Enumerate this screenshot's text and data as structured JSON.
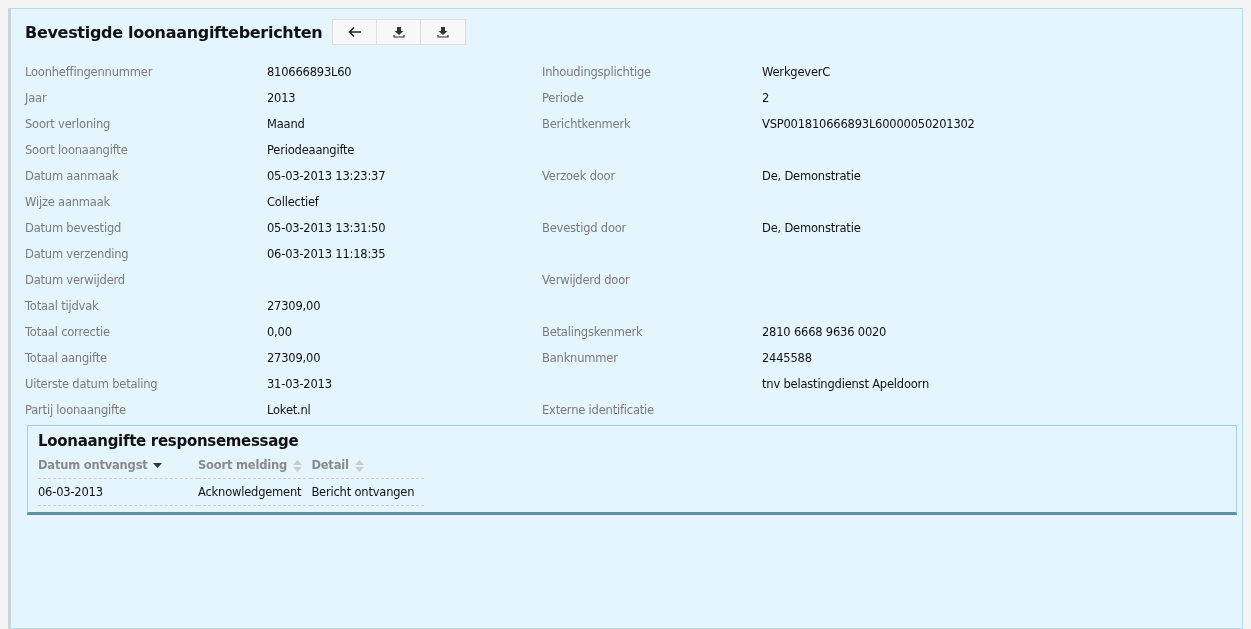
{
  "title": "Bevestigde loonaangifteberichten",
  "toolbar": [
    {
      "kind": "back"
    },
    {
      "kind": "download"
    },
    {
      "kind": "download"
    }
  ],
  "fields": [
    {
      "label": "Loonheffingennummer",
      "value": "810666893L60",
      "label_2": "Inhoudingsplichtige",
      "value_2": "WerkgeverC"
    },
    {
      "label": "Jaar",
      "value": "2013",
      "label_2": "Periode",
      "value_2": "2"
    },
    {
      "label": "Soort verloning",
      "value": "Maand",
      "label_2": "Berichtkenmerk",
      "value_2": "VSP001810666893L60000050201302"
    },
    {
      "label": "Soort loonaangifte",
      "value": "Periodeaangifte"
    },
    {
      "label": "Datum aanmaak",
      "value": "05-03-2013 13:23:37",
      "label_2": "Verzoek door",
      "value_2": "De, Demonstratie"
    },
    {
      "label": "Wijze aanmaak",
      "value": "Collectief"
    },
    {
      "label": "Datum bevestigd",
      "value": "05-03-2013 13:31:50",
      "label_2": "Bevestigd door",
      "value_2": "De, Demonstratie"
    },
    {
      "label": "Datum verzending",
      "value": "06-03-2013 11:18:35"
    },
    {
      "label": "Datum verwijderd",
      "label_2": "Verwijderd door"
    },
    {
      "label": "Totaal tijdvak",
      "value": "27309,00"
    },
    {
      "label": "Totaal correctie",
      "value": "0,00",
      "label_2": "Betalingskenmerk",
      "value_2": "2810 6668 9636 0020"
    },
    {
      "label": "Totaal aangifte",
      "value": "27309,00",
      "label_2": "Banknummer",
      "value_2": "2445588"
    },
    {
      "label": "Uiterste datum betaling",
      "value": "31-03-2013",
      "value_2": "tnv belastingdienst Apeldoorn"
    },
    {
      "label": "Partij loonaangifte",
      "value": "Loket.nl",
      "label_2": "Externe identificatie"
    }
  ],
  "response": {
    "title": "Loonaangifte responsemessage",
    "columns": [
      {
        "label": "Datum ontvangst",
        "sorted": true
      },
      {
        "label": "Soort melding",
        "sorted": false
      },
      {
        "label": "Detail",
        "sorted": false
      }
    ],
    "rows": [
      [
        "06-03-2013",
        "Acknowledgement",
        "Bericht ontvangen"
      ]
    ]
  }
}
